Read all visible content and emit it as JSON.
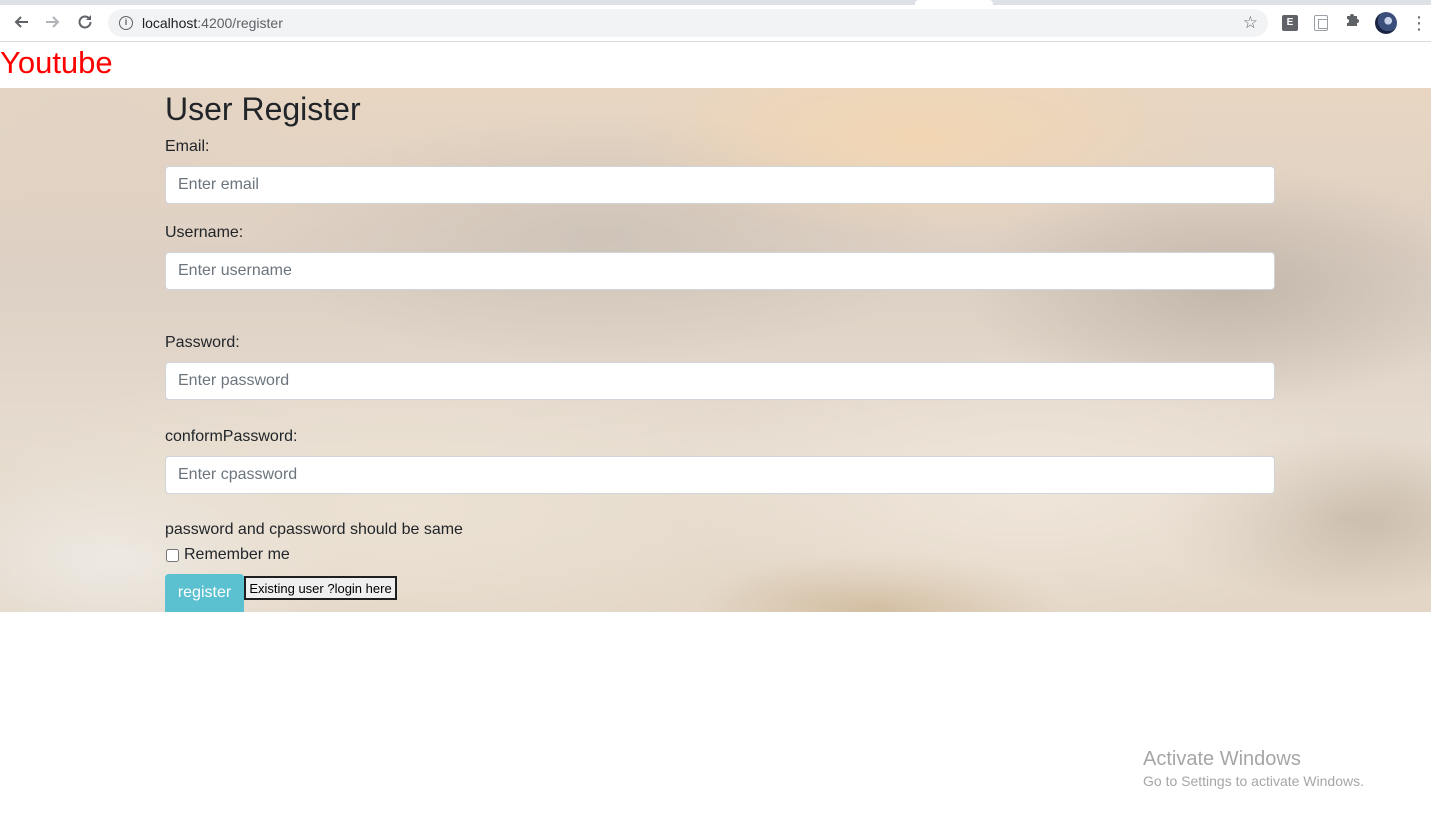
{
  "browser": {
    "url_host": "localhost",
    "url_path": ":4200/register",
    "extension_badge": "E"
  },
  "header": {
    "brand": "Youtube",
    "brand_color": "#ff0000"
  },
  "form": {
    "title": "User Register",
    "email": {
      "label": "Email:",
      "placeholder": "Enter email",
      "value": ""
    },
    "username": {
      "label": "Username:",
      "placeholder": "Enter username",
      "value": ""
    },
    "password": {
      "label": "Password:",
      "placeholder": "Enter password",
      "value": ""
    },
    "cpassword": {
      "label": "conformPassword:",
      "placeholder": "Enter cpassword",
      "value": ""
    },
    "hint": "password and cpassword should be same",
    "remember_label": "Remember me",
    "remember_checked": false,
    "register_label": "register",
    "login_label": "Existing user ?login here",
    "accent_color": "#5bc0cf"
  },
  "watermark": {
    "title": "Activate Windows",
    "subtitle": "Go to Settings to activate Windows."
  },
  "icons": {
    "back": "back-arrow-icon",
    "forward": "forward-arrow-icon",
    "reload": "reload-icon",
    "info": "info-icon",
    "star": "star-icon",
    "extensions": "puzzle-icon",
    "menu": "kebab-menu-icon"
  }
}
